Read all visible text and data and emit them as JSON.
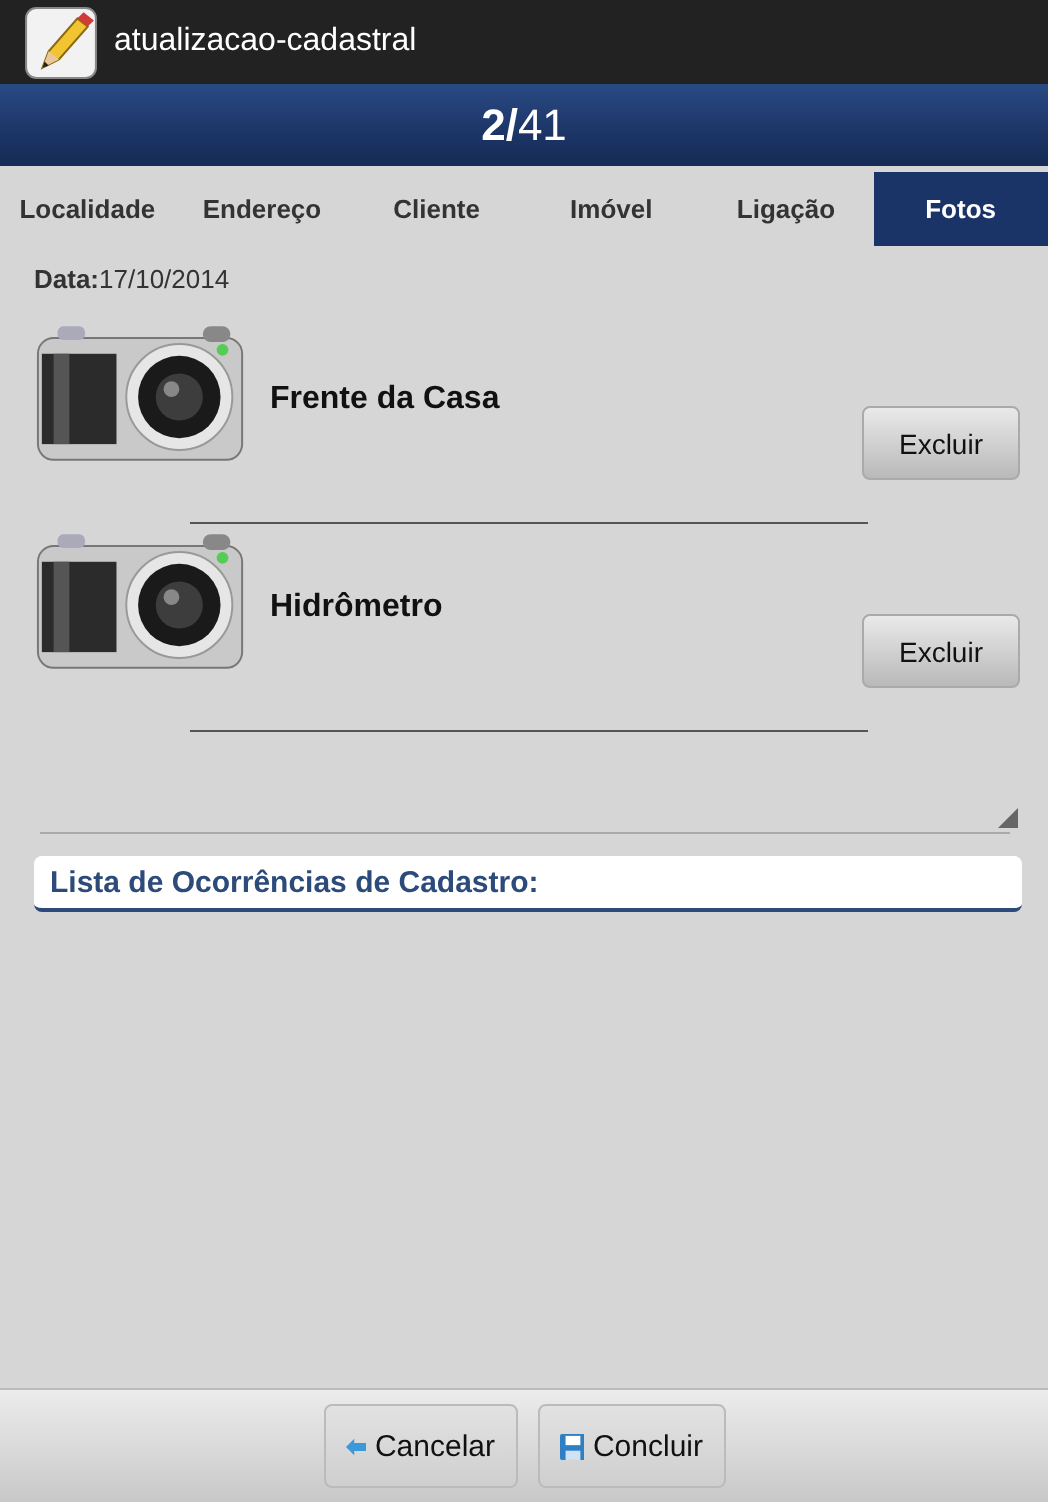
{
  "window": {
    "title": "atualizacao-cadastral"
  },
  "header": {
    "counter": "**2/**41"
  },
  "tabs": [
    {
      "label": "Localidade",
      "selected": false
    },
    {
      "label": "Endereço",
      "selected": false
    },
    {
      "label": "Cliente",
      "selected": false
    },
    {
      "label": "Imóvel",
      "selected": false
    },
    {
      "label": "Ligação",
      "selected": false
    },
    {
      "label": "Fotos",
      "selected": true
    }
  ],
  "date": "**Data:**17/10/2014",
  "photos": [
    {
      "label": "Frente da Casa",
      "button": "Excluir"
    },
    {
      "label": "Hidrômetro",
      "button": "Excluir"
    }
  ],
  "occurrences": {
    "title": "Lista de Ocorrências de Cadastro:"
  },
  "footer": {
    "buttons": [
      {
        "kind": "back",
        "label": "Cancelar"
      },
      {
        "kind": "save",
        "label": "Concluir"
      }
    ]
  }
}
